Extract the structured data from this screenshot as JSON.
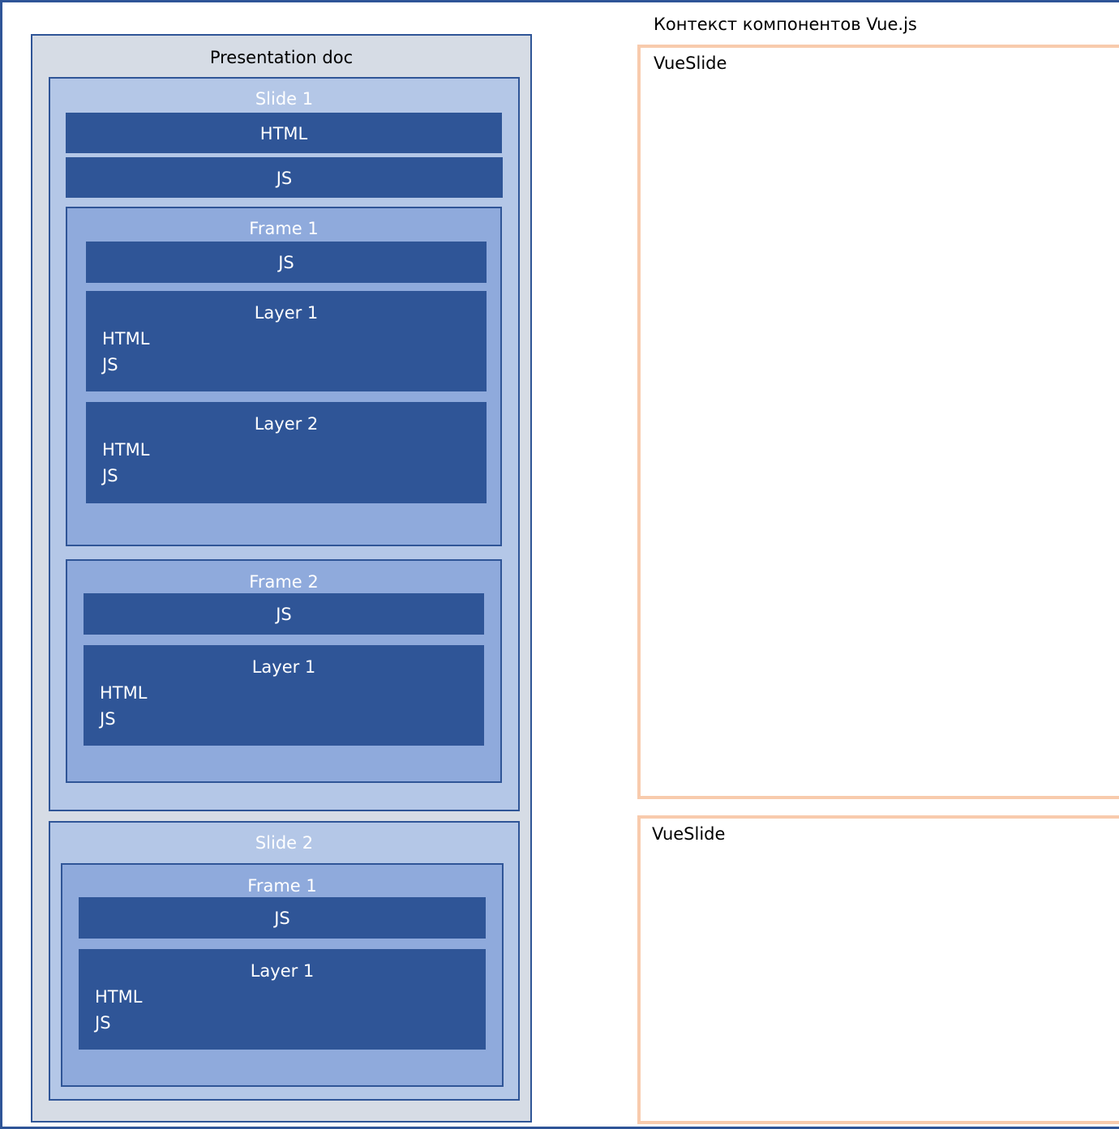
{
  "context_title": "Контекст компонентов Vue.js",
  "presentation": {
    "title": "Presentation doc",
    "slide1": {
      "title": "Slide 1",
      "html": "HTML",
      "js": "JS",
      "frame1": {
        "title": "Frame 1",
        "js": "JS",
        "layer1": {
          "title": "Layer 1",
          "html": "HTML",
          "js": "JS"
        },
        "layer2": {
          "title": "Layer 2",
          "html": "HTML",
          "js": "JS"
        }
      },
      "frame2": {
        "title": "Frame 2",
        "js": "JS",
        "layer1": {
          "title": "Layer 1",
          "html": "HTML",
          "js": "JS"
        }
      }
    },
    "slide2": {
      "title": "Slide 2",
      "frame1": {
        "title": "Frame 1",
        "js": "JS",
        "layer1": {
          "title": "Layer 1",
          "html": "HTML",
          "js": "JS"
        }
      }
    }
  },
  "vue_components": [
    {
      "label": "VueSlide"
    },
    {
      "label": "VueSlide"
    }
  ],
  "colors": {
    "doc_bg": "#D6DCE5",
    "slide_bg": "#B4C7E7",
    "frame_bg": "#8FAADC",
    "block_bg": "#2F5597",
    "border": "#2F5597",
    "vue_border": "#F8CBAD"
  }
}
